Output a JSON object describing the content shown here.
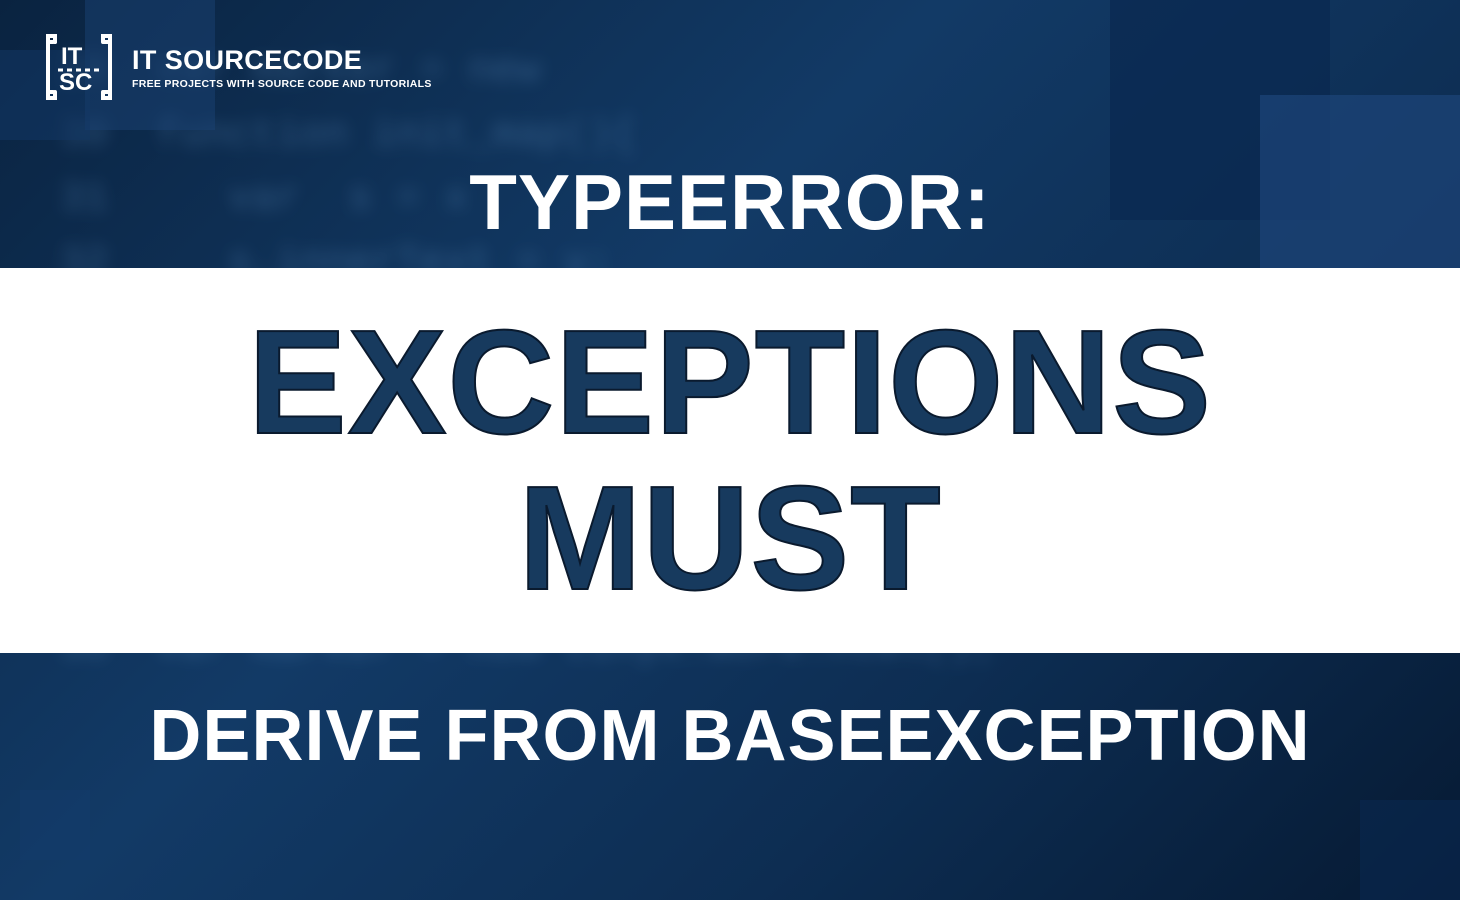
{
  "logo": {
    "brand": "IT SOURCECODE",
    "tagline": "FREE PROJECTS WITH SOURCE CODE AND TUTORIALS"
  },
  "title": {
    "line1": "TYPEERROR:",
    "band_line1": "EXCEPTIONS",
    "band_line2": "MUST",
    "line2": "DERIVE FROM BASEEXCEPTION"
  },
  "bg_code_sample": "29  var marker = new\n30  function init_map(){\n31     var  s = x\n32     s.innerText = y;\n33  }\n34     Alert(\"Name must be filled in\")\n35  }\n36  }\n37  }\n38  var marker = new tinyk.work.html();"
}
